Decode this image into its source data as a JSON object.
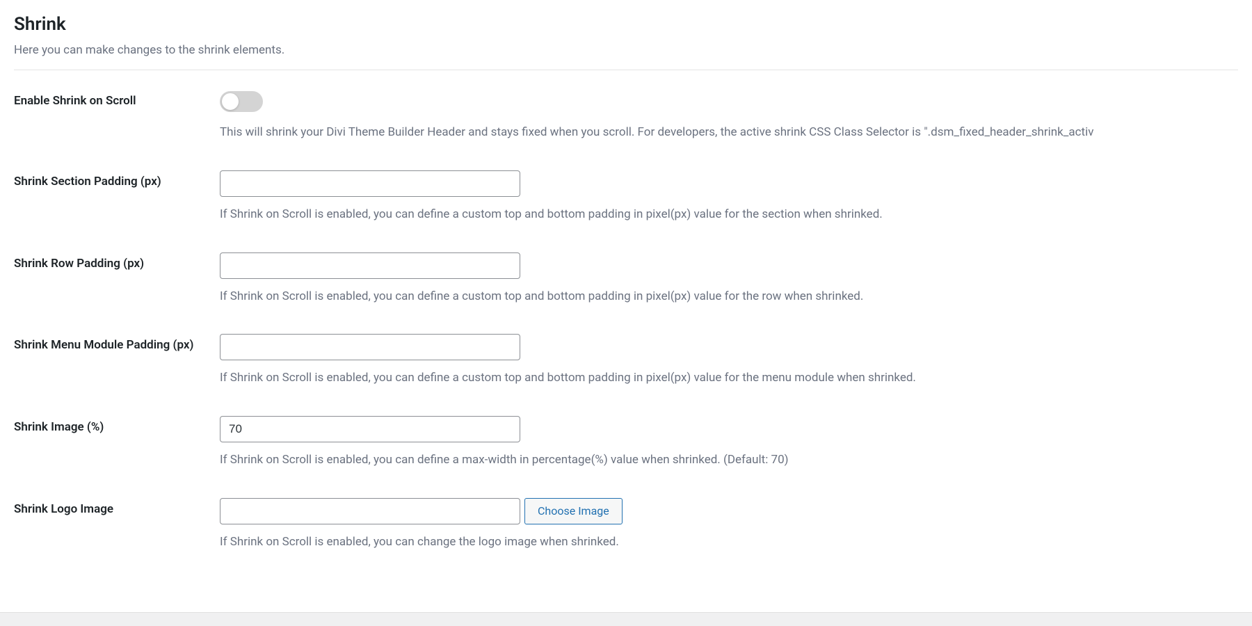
{
  "section": {
    "title": "Shrink",
    "description": "Here you can make changes to the shrink elements."
  },
  "fields": {
    "enable_shrink": {
      "label": "Enable Shrink on Scroll",
      "description": "This will shrink your Divi Theme Builder Header and stays fixed when you scroll. For developers, the active shrink CSS Class Selector is \".dsm_fixed_header_shrink_activ",
      "value": false
    },
    "section_padding": {
      "label": "Shrink Section Padding (px)",
      "description": "If Shrink on Scroll is enabled, you can define a custom top and bottom padding in pixel(px) value for the section when shrinked.",
      "value": ""
    },
    "row_padding": {
      "label": "Shrink Row Padding (px)",
      "description": "If Shrink on Scroll is enabled, you can define a custom top and bottom padding in pixel(px) value for the row when shrinked.",
      "value": ""
    },
    "menu_padding": {
      "label": "Shrink Menu Module Padding (px)",
      "description": "If Shrink on Scroll is enabled, you can define a custom top and bottom padding in pixel(px) value for the menu module when shrinked.",
      "value": ""
    },
    "shrink_image": {
      "label": "Shrink Image (%)",
      "description": "If Shrink on Scroll is enabled, you can define a max-width in percentage(%) value when shrinked. (Default: 70)",
      "value": "70"
    },
    "logo_image": {
      "label": "Shrink Logo Image",
      "description": "If Shrink on Scroll is enabled, you can change the logo image when shrinked.",
      "value": "",
      "button_label": "Choose Image"
    }
  }
}
